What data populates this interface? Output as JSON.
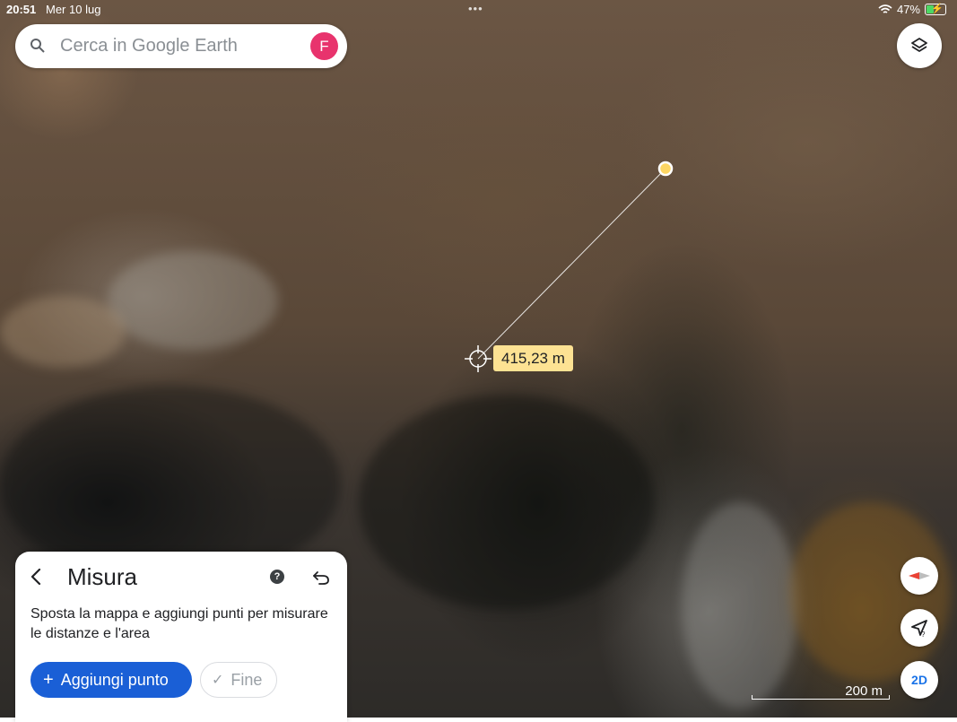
{
  "status_bar": {
    "time": "20:51",
    "date": "Mer 10 lug",
    "battery": "47%",
    "battery_level": 0.47
  },
  "search": {
    "placeholder": "Cerca in Google Earth",
    "avatar_initial": "F"
  },
  "map": {
    "distance_label": "415,23 m",
    "scale_label": "200 m",
    "view_mode": "2D"
  },
  "icons": {
    "search": "search-icon",
    "layers": "layers-icon",
    "compass": "compass-icon",
    "my_location": "my-location-icon",
    "back": "back-arrow-icon",
    "help": "help-icon",
    "undo": "undo-icon",
    "check": "check-icon",
    "plus": "plus-icon"
  },
  "measure_panel": {
    "title": "Misura",
    "help_symbol": "?",
    "description": "Sposta la mappa e aggiungi punti per misurare le distanze e l'area",
    "add_point_label": "Aggiungi punto",
    "done_label": "Fine"
  },
  "colors": {
    "accent": "#1a5fd6",
    "avatar": "#e8336d",
    "distance_label_bg": "#fde293",
    "measure_point": "#fdd663"
  }
}
